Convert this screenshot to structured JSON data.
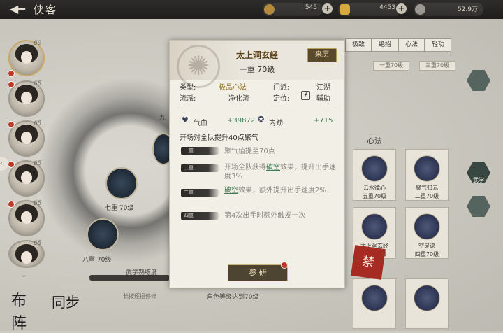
{
  "topbar": {
    "back_icon": "back-arrow-icon",
    "title": "侠客",
    "resources": [
      {
        "icon": "leaf-currency-icon",
        "value": "545"
      },
      {
        "icon": "gold-ingot-icon",
        "value": "4453"
      },
      {
        "icon": "silver-coin-icon",
        "value": "52.9万"
      }
    ]
  },
  "portraits": [
    {
      "level": "69"
    },
    {
      "level": "65"
    },
    {
      "level": "65"
    },
    {
      "level": "65"
    },
    {
      "level": "65"
    },
    {
      "level": "65"
    }
  ],
  "left_buttons": {
    "formation": "布阵",
    "team": "同步"
  },
  "center": {
    "node1": "七重 70级",
    "node2": "八重 70级",
    "node3": "九",
    "progress_label": "武学熟练度",
    "progress_sub": "长按逐招停修",
    "requirement": "角色等级达到70级"
  },
  "right_panel": {
    "tabs": [
      "极致",
      "绝招",
      "心法",
      "轻功"
    ],
    "top_cards": [
      "一重70级",
      "三重70级"
    ],
    "section_title": "心法",
    "cards": [
      {
        "name": "云水律心",
        "level": "五重70级"
      },
      {
        "name": "聚气归元",
        "level": "二重70级"
      },
      {
        "name": "太上洞玄经",
        "level": "四重70级"
      },
      {
        "name": "空灵诀",
        "level": "四重70级"
      }
    ],
    "hex_tabs": [
      "",
      "武学",
      ""
    ],
    "seal_text": "禁"
  },
  "popup": {
    "title": "太上洞玄经",
    "source_button": "来历",
    "subtitle": "一重 70级",
    "type_label": "类型:",
    "type_value": "极品心法",
    "sect_label": "门派:",
    "sect_value": "江湖",
    "school_label": "流派:",
    "school_value": "净化流",
    "role_label": "定位:",
    "role_value": "辅助",
    "hp_label": "气血",
    "hp_value": "+39872",
    "inner_label": "内劲",
    "inner_value": "+715",
    "base_effect": "开场对全队提升40点聚气",
    "levels": [
      {
        "tag": "一重",
        "text": "聚气值提至70点"
      },
      {
        "tag": "二重",
        "text_a": "开场全队获得",
        "link": "破空",
        "text_b": "效果，提升出手速度3%"
      },
      {
        "tag": "三重",
        "link": "破空",
        "text_b": "效果，额外提升出手速度2%"
      },
      {
        "tag": "四重",
        "text": "第4次出手时额外触发一次"
      }
    ],
    "research_button": "参 研"
  },
  "colors": {
    "accent_gold": "#8a6a1f",
    "stat_green": "#3f7a52",
    "notify_red": "#c23526"
  }
}
